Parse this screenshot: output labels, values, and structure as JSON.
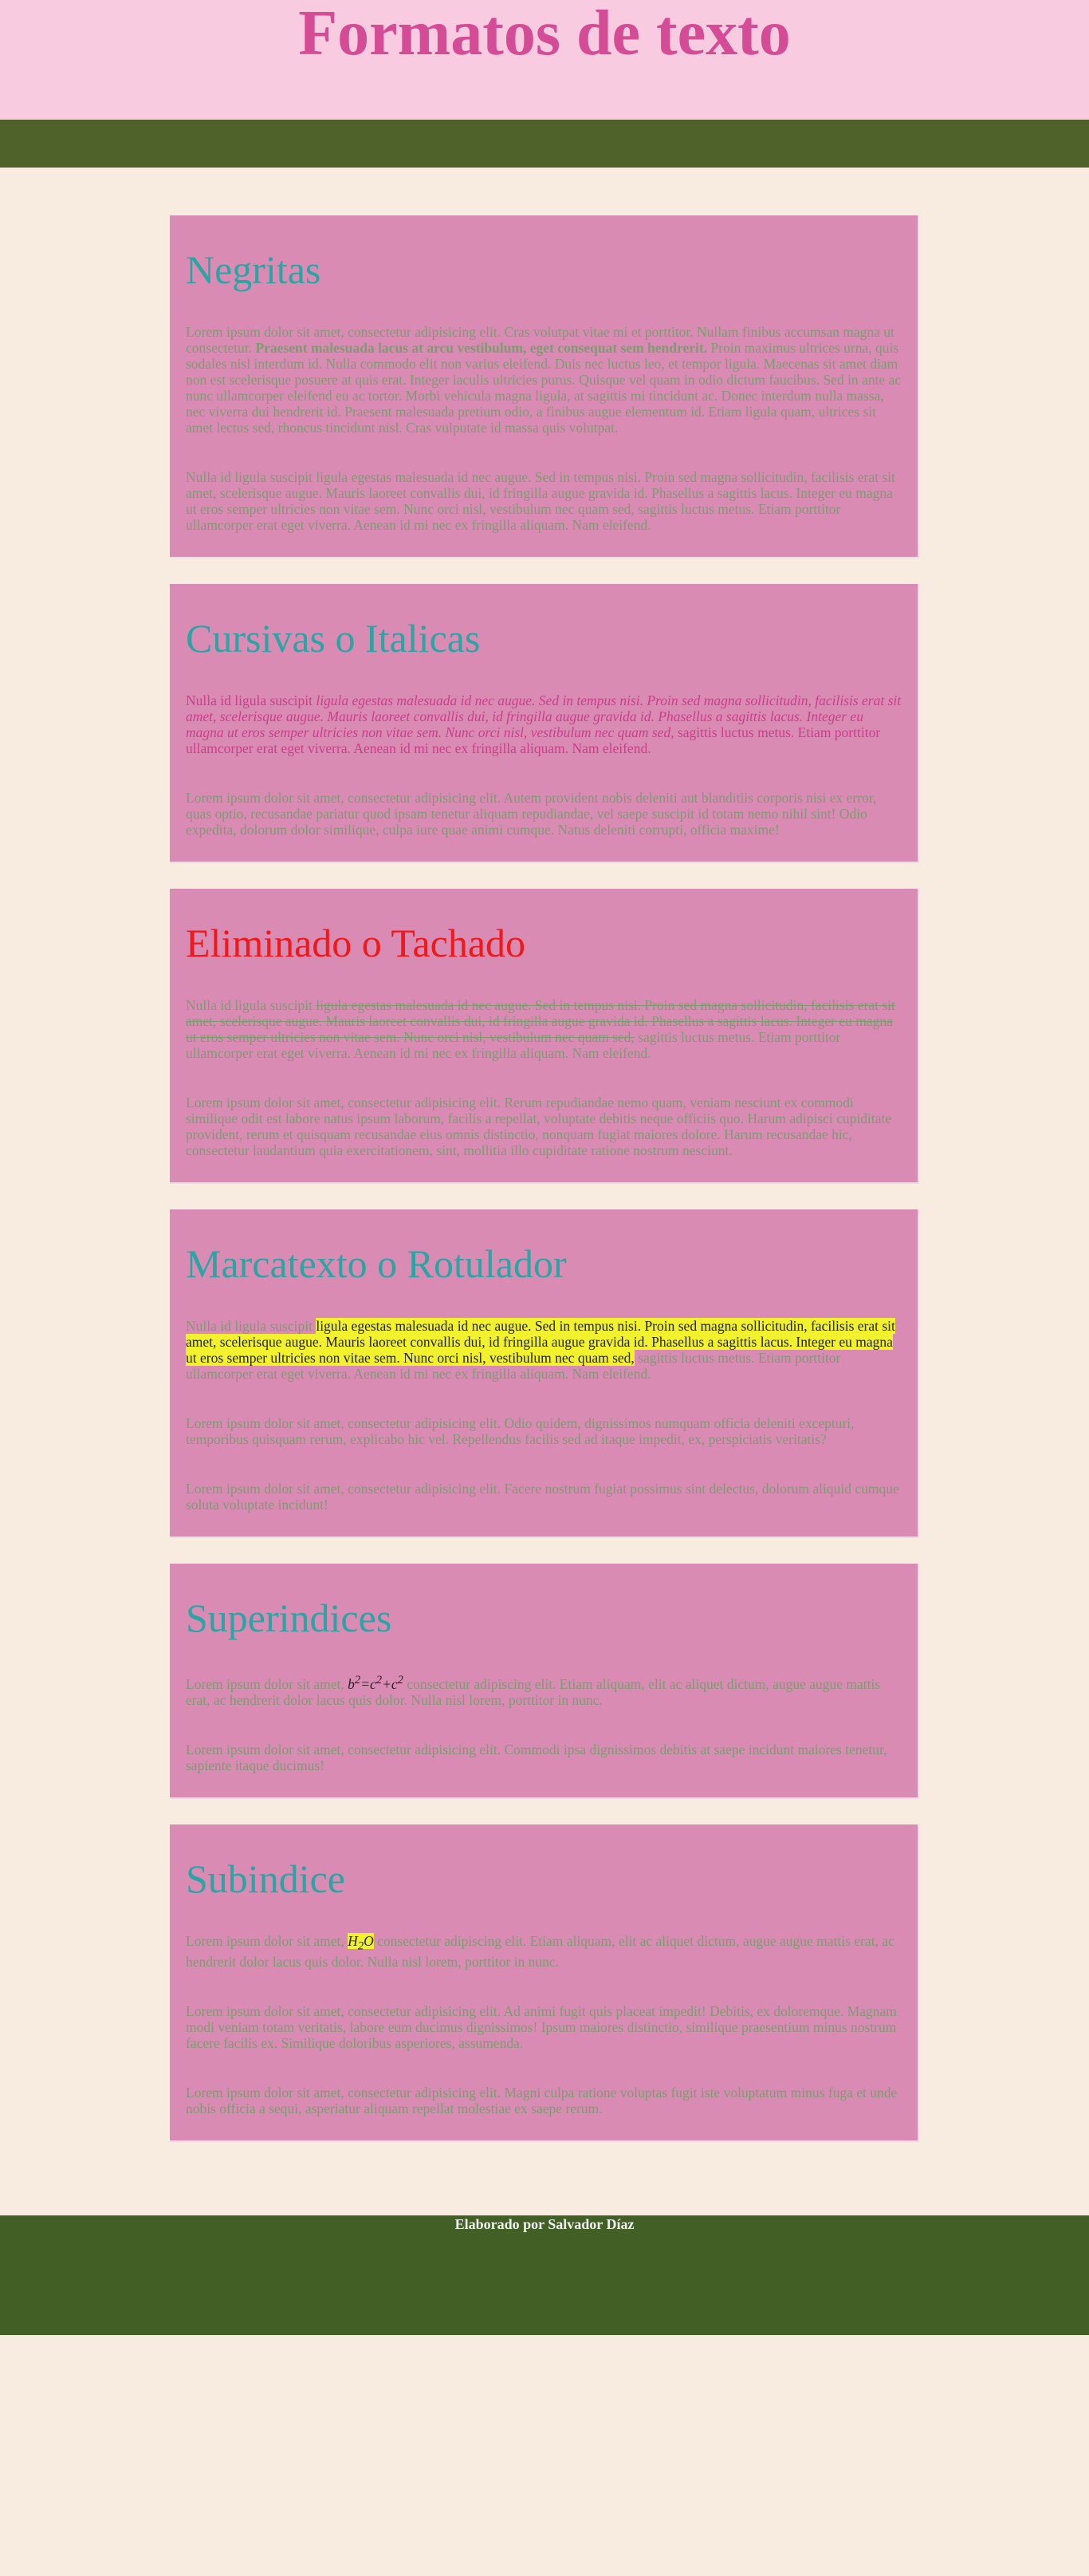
{
  "header": {
    "title": "Formatos de texto"
  },
  "sections": {
    "bold": {
      "title": "Negritas",
      "p1_a": "Lorem ipsum dolor sit amet, consectetur adipisicing elit. Cras volutpat vitae mi et porttitor. Nullam finibus accumsan magna ut consectetur. ",
      "p1_bold": "Praesent malesuada lacus at arcu vestibulum, eget consequat sem hendrerit.",
      "p1_b": " Proin maximus ultrices urna, quis sodales nisl interdum id. Nulla commodo elit non varius eleifend. Duis nec luctus leo, et tempor ligula. Maecenas sit amet diam non est scelerisque posuere at quis erat. Integer iaculis ultricies purus. Quisque vel quam in odio dictum faucibus. Sed in ante ac nunc ullamcorper eleifend eu ac tortor. Morbi vehicula magna ligula, at sagittis mi tincidunt ac. Donec interdum nulla massa, nec viverra dui hendrerit id. Praesent malesuada pretium odio, a finibus augue elementum id. Etiam ligula quam, ultrices sit amet lectus sed, rhoncus tincidunt nisl. Cras vulputate id massa quis volutpat.",
      "p2": "Nulla id ligula suscipit ligula egestas malesuada id nec augue. Sed in tempus nisi. Proin sed magna sollicitudin, facilisis erat sit amet, scelerisque augue. Mauris laoreet convallis dui, id fringilla augue gravida id. Phasellus a sagittis lacus. Integer eu magna ut eros semper ultricies non vitae sem. Nunc orci nisl, vestibulum nec quam sed, sagittis luctus metus. Etiam porttitor ullamcorper erat eget viverra. Aenean id mi nec ex fringilla aliquam. Nam eleifend."
    },
    "italic": {
      "title": "Cursivas o Italicas",
      "p1_a": "Nulla id ligula suscipit ",
      "p1_em": "ligula egestas malesuada id nec augue. Sed in tempus nisi. Proin sed magna sollicitudin, facilisis erat sit amet, scelerisque augue. Mauris laoreet convallis dui, id fringilla augue gravida id. Phasellus a sagittis lacus. Integer eu magna ut eros semper ultricies non vitae sem. Nunc orci nisl, vestibulum nec quam sed,",
      "p1_b": " sagittis luctus metus. Etiam porttitor ullamcorper erat eget viverra. Aenean id mi nec ex fringilla aliquam. Nam eleifend.",
      "p2": "Lorem ipsum dolor sit amet, consectetur adipisicing elit. Autem provident nobis deleniti aut blanditiis corporis nisi ex error, quas optio, recusandae pariatur quod ipsam tenetur aliquam repudiandae, vel saepe suscipit id totam nemo nihil sint! Odio expedita, dolorum dolor similique, culpa iure quae animi cumque. Natus deleniti corrupti, officia maxime!"
    },
    "strike": {
      "title": "Eliminado o Tachado",
      "p1_a": "Nulla id ligula suscipit ",
      "p1_del": "ligula egestas malesuada id nec augue. Sed in tempus nisi. Proin sed magna sollicitudin, facilisis erat sit amet, scelerisque augue. Mauris laoreet convallis dui, id fringilla augue gravida id. Phasellus a sagittis lacus. Integer eu magna ut eros semper ultricies non vitae sem. Nunc orci nisl, vestibulum nec quam sed,",
      "p1_b": " sagittis luctus metus. Etiam porttitor ullamcorper erat eget viverra. Aenean id mi nec ex fringilla aliquam. Nam eleifend.",
      "p2": "Lorem ipsum dolor sit amet, consectetur adipisicing elit. Rerum repudiandae nemo quam, veniam nesciunt ex commodi similique odit est labore natus ipsum laborum, facilis a repellat, voluptate debitis neque officiis quo. Harum adipisci cupiditate provident, rerum et quisquam recusandae eius omnis distinctio, nonquam fugiat maiores dolore. Harum recusandae hic, consectetur laudantium quia exercitationem, sint, mollitia illo cupiditate ratione nostrum nesciunt."
    },
    "highlight": {
      "title": "Marcatexto o Rotulador",
      "p1_a": "Nulla id ligula suscipit ",
      "p1_mark": "ligula egestas malesuada id nec augue. Sed in tempus nisi. Proin sed magna sollicitudin, facilisis erat sit amet, scelerisque augue. Mauris laoreet convallis dui, id fringilla augue gravida id. Phasellus a sagittis lacus. Integer eu magna ut eros semper ultricies non vitae sem. Nunc orci nisl, vestibulum nec quam sed,",
      "p1_b": " sagittis luctus metus. Etiam porttitor ullamcorper erat eget viverra. Aenean id mi nec ex fringilla aliquam. Nam eleifend.",
      "p2": "Lorem ipsum dolor sit amet, consectetur adipisicing elit. Odio quidem, dignissimos numquam officia deleniti excepturi, temporibus quisquam rerum, explicabo hic vel. Repellendus facilis sed ad itaque impedit, ex, perspiciatis veritatis?",
      "p3": "Lorem ipsum dolor sit amet, consectetur adipisicing elit. Facere nostrum fugiat possimus sint delectus, dolorum aliquid cumque soluta voluptate incidunt!"
    },
    "sup": {
      "title": "Superindices",
      "p1_a": "Lorem ipsum dolor sit amet, ",
      "b": "b",
      "exp1": "2",
      "eq": "=c",
      "exp2": "2",
      "plus": "+c",
      "exp3": "2",
      "p1_b": " consectetur adipiscing elit. Etiam aliquam, elit ac aliquet dictum, augue augue mattis erat, ac hendrerit dolor lacus quis dolor. Nulla nisl lorem, porttitor in nunc.",
      "p2": "Lorem ipsum dolor sit amet, consectetur adipisicing elit. Commodi ipsa dignissimos debitis at saepe incidunt maiores tenetur, sapiente itaque ducimus!"
    },
    "sub": {
      "title": "Subindice",
      "p1_a": "Lorem ipsum dolor sit amet, ",
      "h": "H",
      "sub": "2",
      "o": "O",
      "p1_b": " consectetur adipiscing elit. Etiam aliquam, elit ac aliquet dictum, augue augue mattis erat, ac hendrerit dolor lacus quis dolor. Nulla nisl lorem, porttitor in nunc.",
      "p2": "Lorem ipsum dolor sit amet, consectetur adipisicing elit. Ad animi fugit quis placeat impedit! Debitis, ex doloremque. Magnam modi veniam totam veritatis, labore eum ducimus dignissimos! Ipsum maiores distinctio, similique praesentium minus nostrum facere facilis ex. Similique doloribus asperiores, assumenda.",
      "p3": "Lorem ipsum dolor sit amet, consectetur adipisicing elit. Magni culpa ratione voluptas fugit iste voluptatum minus fuga et unde nobis officia a sequi, asperiatur aliquam repellat molestiae ex saepe rerum."
    }
  },
  "footer": {
    "text": "Elaborado por Salvador Díaz"
  },
  "colors": {
    "header_bg": "#f8cbe1",
    "title": "#d34c95",
    "nav_bg": "#4f6229",
    "card_bg": "#da8bb4",
    "heading": "#2aa5a3",
    "heading_alt": "#f01818",
    "body_text": "#7f9a73",
    "highlight": "#f2f12e",
    "footer_bg": "#425f25"
  }
}
